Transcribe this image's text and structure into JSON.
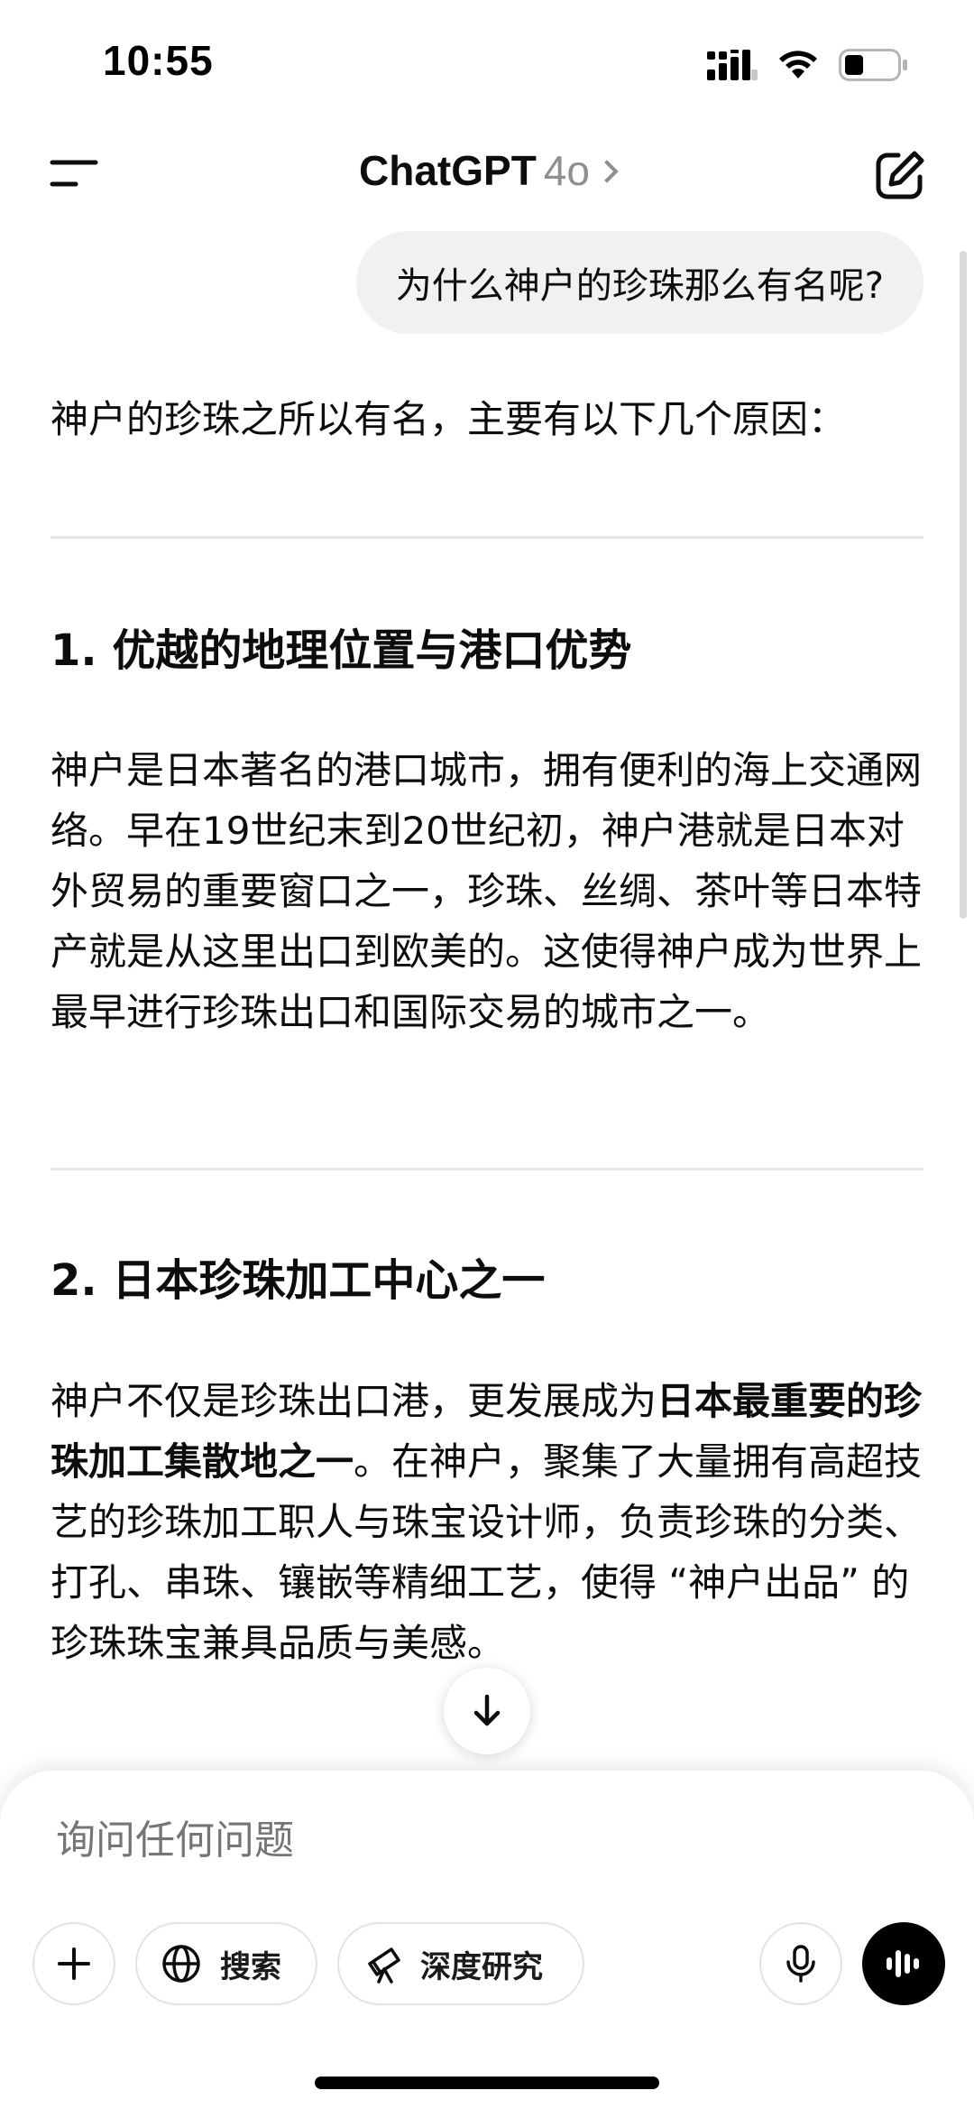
{
  "status_bar": {
    "time": "10:55"
  },
  "header": {
    "title": "ChatGPT",
    "model": "4o"
  },
  "user_message": "为什么神户的珍珠那么有名呢?",
  "assistant": {
    "intro": "神户的珍珠之所以有名，主要有以下几个原因：",
    "section1": {
      "heading": "1. 优越的地理位置与港口优势",
      "body": "神户是日本著名的港口城市，拥有便利的海上交通网络。早在19世纪末到20世纪初，神户港就是日本对外贸易的重要窗口之一，珍珠、丝绸、茶叶等日本特产就是从这里出口到欧美的。这使得神户成为世界上最早进行珍珠出口和国际交易的城市之一。"
    },
    "section2": {
      "heading": "2. 日本珍珠加工中心之一",
      "body_pre": "神户不仅是珍珠出口港，更发展成为",
      "body_bold": "日本最重要的珍珠加工集散地之一",
      "body_post": "。在神户，聚集了大量拥有高超技艺的珍珠加工职人与珠宝设计师，负责珍珠的分类、打孔、串珠、镶嵌等精细工艺，使得 “神户出品” 的珍珠珠宝兼具品质与美感。"
    }
  },
  "composer": {
    "placeholder": "询问任何问题",
    "search_label": "搜索",
    "research_label": "深度研究"
  },
  "icons": {
    "menu": "menu-icon",
    "compose": "compose-icon",
    "scroll_down": "arrow-down-icon",
    "plus": "plus-icon",
    "globe": "globe-icon",
    "telescope": "telescope-icon",
    "mic": "mic-icon",
    "voice": "voice-waveform-icon"
  }
}
